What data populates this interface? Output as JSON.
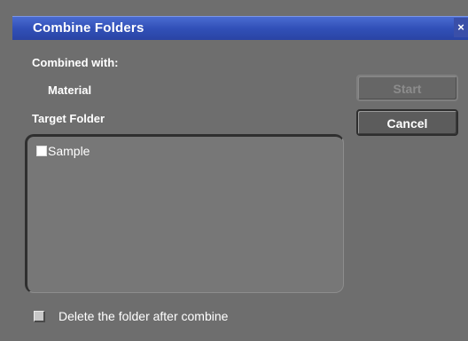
{
  "window": {
    "title": "Combine Folders",
    "close_glyph": "×"
  },
  "combined_with": {
    "label": "Combined with:",
    "value": "Material"
  },
  "target_folder": {
    "label": "Target Folder",
    "items": [
      {
        "label": "Sample",
        "checked": false
      }
    ]
  },
  "buttons": {
    "start_label": "Start",
    "start_enabled": false,
    "cancel_label": "Cancel"
  },
  "options": {
    "delete_after_label": "Delete the folder after combine",
    "delete_after_checked": false
  },
  "colors": {
    "titlebar": "#3150b8",
    "background": "#6e6e6e",
    "panel": "#777777"
  }
}
